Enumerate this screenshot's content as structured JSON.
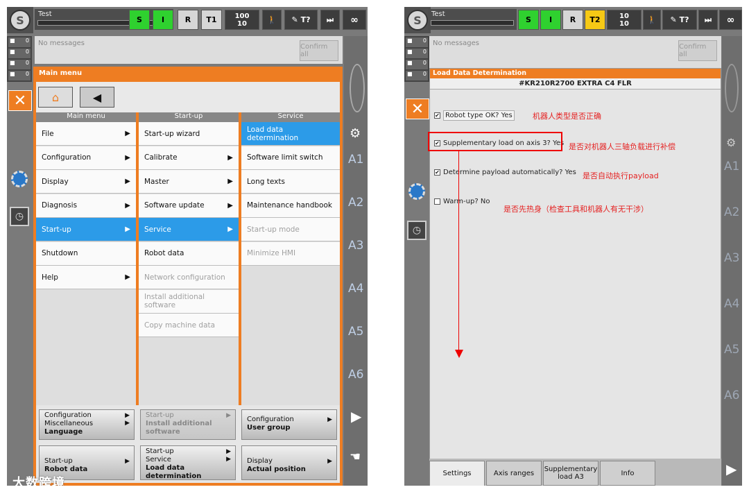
{
  "left": {
    "robot_name": "Test",
    "header_buttons": [
      "S",
      "I",
      "R",
      "T1"
    ],
    "override": {
      "top": "100",
      "bottom": "10"
    },
    "infinity": "∞",
    "counts": [
      "0",
      "0",
      "0",
      "0"
    ],
    "messages": "No messages",
    "confirm_all": "Confirm all",
    "main_menu_title": "Main menu",
    "col_headers": [
      "Main menu",
      "Start-up",
      "Service"
    ],
    "col1": [
      {
        "label": "File",
        "arrow": "▶"
      },
      {
        "label": "Configuration",
        "arrow": "▶"
      },
      {
        "label": "Display",
        "arrow": "▶"
      },
      {
        "label": "Diagnosis",
        "arrow": "▶"
      },
      {
        "label": "Start-up",
        "arrow": "▶"
      },
      {
        "label": "Shutdown",
        "arrow": ""
      },
      {
        "label": "Help",
        "arrow": "▶"
      }
    ],
    "col2": [
      {
        "label": "Start-up wizard",
        "arrow": ""
      },
      {
        "label": "Calibrate",
        "arrow": "▶"
      },
      {
        "label": "Master",
        "arrow": "▶"
      },
      {
        "label": "Software update",
        "arrow": "▶"
      },
      {
        "label": "Service",
        "arrow": "▶"
      },
      {
        "label": "Robot data",
        "arrow": ""
      },
      {
        "label": "Network configuration",
        "arrow": ""
      },
      {
        "label": "Install additional software",
        "arrow": ""
      },
      {
        "label": "Copy machine data",
        "arrow": ""
      }
    ],
    "col3": [
      {
        "label": "Load data determination"
      },
      {
        "label": "Software limit switch"
      },
      {
        "label": "Long texts"
      },
      {
        "label": "Maintenance handbook"
      },
      {
        "label": "Start-up mode"
      },
      {
        "label": "Minimize HMI"
      }
    ],
    "shortcuts": [
      {
        "l1": "Configuration",
        "l2": "Miscellaneous",
        "l3": "Language"
      },
      {
        "l1": "Start-up",
        "l2": "Install additional",
        "l3": "software"
      },
      {
        "l1": "Configuration",
        "l2": "User group",
        "l3": ""
      },
      {
        "l1": "Start-up",
        "l2": "Robot data",
        "l3": ""
      },
      {
        "l1": "Start-up",
        "l2": "Service",
        "l3": "Load data",
        "l4": "determination"
      },
      {
        "l1": "Display",
        "l2": "Actual position",
        "l3": ""
      }
    ],
    "axes": [
      "A1",
      "A2",
      "A3",
      "A4",
      "A5",
      "A6"
    ],
    "watermark": "大数跨境"
  },
  "right": {
    "robot_name": "Test",
    "header_buttons": [
      "S",
      "I",
      "R",
      "T2"
    ],
    "override": {
      "top": "10",
      "bottom": "10"
    },
    "infinity": "∞",
    "counts": [
      "0",
      "0",
      "0",
      "0"
    ],
    "messages": "No messages",
    "confirm_all": "Confirm all",
    "title": "Load Data Determination",
    "subtitle": "#KR210R2700 EXTRA C4 FLR",
    "checks": [
      {
        "label": "Robot type OK? Yes",
        "note": "机器人类型是否正确",
        "checked": "✔"
      },
      {
        "label": "Supplementary load on axis 3? Yes",
        "note": "是否对机器人三轴负载进行补偿",
        "checked": "✔"
      },
      {
        "label": "Determine payload automatically? Yes",
        "note": "是否自动执行payload",
        "checked": "✔"
      },
      {
        "label": "Warm-up? No",
        "note": "是否先热身（检查工具和机器人有无干涉）",
        "checked": ""
      }
    ],
    "tabs": [
      "Settings",
      "Axis ranges",
      "Supplementary load A3",
      "Info"
    ],
    "axes": [
      "A1",
      "A2",
      "A3",
      "A4",
      "A5",
      "A6"
    ]
  }
}
